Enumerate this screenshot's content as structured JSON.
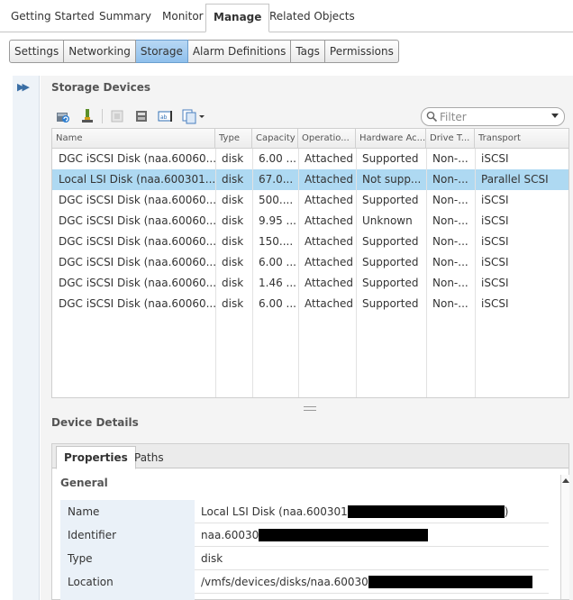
{
  "top_tabs": [
    {
      "label": "Getting Started",
      "active": false
    },
    {
      "label": "Summary",
      "active": false
    },
    {
      "label": "Monitor",
      "active": false
    },
    {
      "label": "Manage",
      "active": true
    },
    {
      "label": "Related Objects",
      "active": false
    }
  ],
  "sub_tabs": [
    {
      "label": "Settings",
      "active": false
    },
    {
      "label": "Networking",
      "active": false
    },
    {
      "label": "Storage",
      "active": true
    },
    {
      "label": "Alarm Definitions",
      "active": false
    },
    {
      "label": "Tags",
      "active": false
    },
    {
      "label": "Permissions",
      "active": false
    }
  ],
  "storage_devices": {
    "title": "Storage Devices",
    "filter_placeholder": "Filter",
    "toolbar_icons": [
      "refresh-icon",
      "attach-icon",
      "detach-icon",
      "rescan-icon",
      "rename-icon",
      "copy-menu-icon"
    ],
    "columns": [
      "Name",
      "Type",
      "Capacity",
      "Operatio...",
      "Hardware Ac...",
      "Drive T...",
      "Transport"
    ],
    "rows": [
      {
        "name": "DGC iSCSI Disk (naa.60060...",
        "type": "disk",
        "capacity": "6.00 ...",
        "operational": "Attached",
        "hardware": "Supported",
        "drive": "Non-...",
        "transport": "iSCSI",
        "selected": false
      },
      {
        "name": "Local LSI Disk (naa.600301...",
        "type": "disk",
        "capacity": "67.0...",
        "operational": "Attached",
        "hardware": "Not supp...",
        "drive": "Non-...",
        "transport": "Parallel SCSI",
        "selected": true
      },
      {
        "name": "DGC iSCSI Disk (naa.60060...",
        "type": "disk",
        "capacity": "500....",
        "operational": "Attached",
        "hardware": "Supported",
        "drive": "Non-...",
        "transport": "iSCSI",
        "selected": false
      },
      {
        "name": "DGC iSCSI Disk (naa.60060...",
        "type": "disk",
        "capacity": "9.95 ...",
        "operational": "Attached",
        "hardware": "Unknown",
        "drive": "Non-...",
        "transport": "iSCSI",
        "selected": false
      },
      {
        "name": "DGC iSCSI Disk (naa.60060...",
        "type": "disk",
        "capacity": "150....",
        "operational": "Attached",
        "hardware": "Supported",
        "drive": "Non-...",
        "transport": "iSCSI",
        "selected": false
      },
      {
        "name": "DGC iSCSI Disk (naa.60060...",
        "type": "disk",
        "capacity": "6.00 ...",
        "operational": "Attached",
        "hardware": "Supported",
        "drive": "Non-...",
        "transport": "iSCSI",
        "selected": false
      },
      {
        "name": "DGC iSCSI Disk (naa.60060...",
        "type": "disk",
        "capacity": "1.46 ...",
        "operational": "Attached",
        "hardware": "Supported",
        "drive": "Non-...",
        "transport": "iSCSI",
        "selected": false
      },
      {
        "name": "DGC iSCSI Disk (naa.60060...",
        "type": "disk",
        "capacity": "6.00 ...",
        "operational": "Attached",
        "hardware": "Supported",
        "drive": "Non-...",
        "transport": "iSCSI",
        "selected": false
      }
    ]
  },
  "device_details": {
    "title": "Device Details",
    "tabs": [
      {
        "label": "Properties",
        "active": true
      },
      {
        "label": "Paths",
        "active": false
      }
    ],
    "section": "General",
    "properties": [
      {
        "name": "Name",
        "value": "Local LSI Disk (naa.600301",
        "suffix": ")"
      },
      {
        "name": "Identifier",
        "value": "naa.60030",
        "suffix": ""
      },
      {
        "name": "Type",
        "value": "disk",
        "suffix": ""
      },
      {
        "name": "Location",
        "value": "/vmfs/devices/disks/naa.60030",
        "suffix": ""
      }
    ]
  }
}
